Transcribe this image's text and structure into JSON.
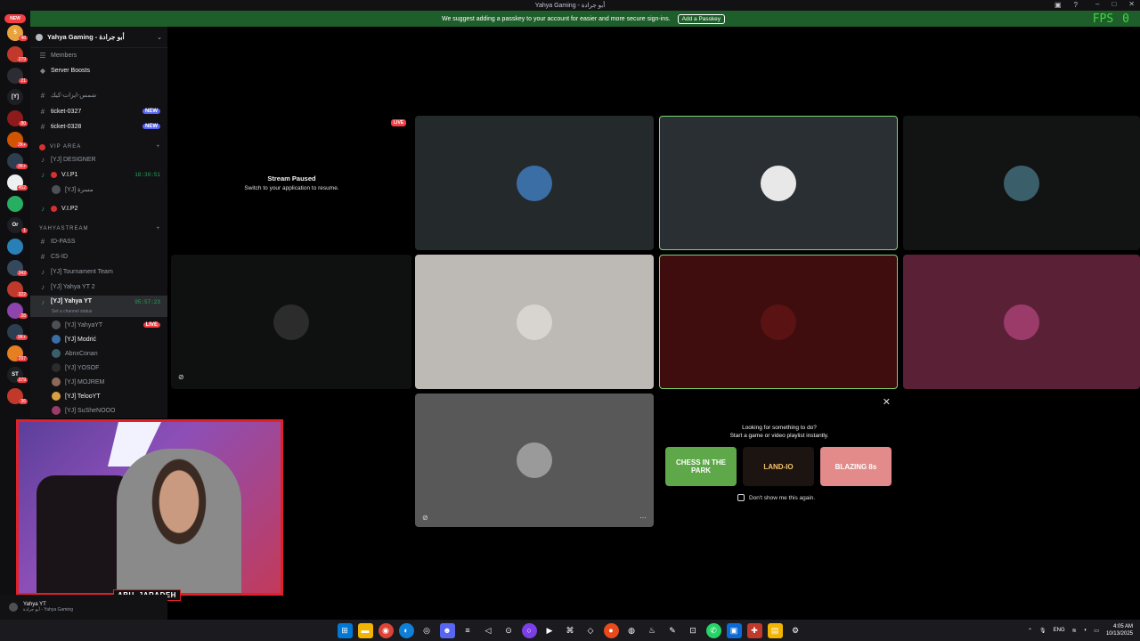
{
  "window": {
    "title": "Yahya Gaming - أبو جرادة"
  },
  "banner": {
    "message": "We suggest adding a passkey to your account for easier and more secure sign-ins.",
    "button": "Add a Passkey"
  },
  "fps": {
    "label": "FPS",
    "value": "0"
  },
  "rail": {
    "new_label": "NEW",
    "servers": [
      {
        "text": "5",
        "color": "#e8a33d",
        "badge": "48"
      },
      {
        "text": "",
        "color": "#c0392b",
        "badge": "279"
      },
      {
        "text": "",
        "color": "#2c2c34",
        "badge": "21"
      },
      {
        "text": "[Y]",
        "color": "#1e1f22",
        "badge": ""
      },
      {
        "text": "",
        "color": "#8e1b1b",
        "badge": "80"
      },
      {
        "text": "",
        "color": "#d35400",
        "badge": "2K+"
      },
      {
        "text": "",
        "color": "#2c3e50",
        "badge": "3K+"
      },
      {
        "text": "",
        "color": "#ecf0f1",
        "badge": "452"
      },
      {
        "text": "",
        "color": "#27ae60",
        "badge": ""
      },
      {
        "text": "Or",
        "color": "#1e1f22",
        "badge": "1"
      },
      {
        "text": "",
        "color": "#2980b9",
        "badge": ""
      },
      {
        "text": "",
        "color": "#34495e",
        "badge": "342"
      },
      {
        "text": "",
        "color": "#c0392b",
        "badge": "322"
      },
      {
        "text": "",
        "color": "#8e44ad",
        "badge": "28"
      },
      {
        "text": "",
        "color": "#2c3e50",
        "badge": "9K+"
      },
      {
        "text": "",
        "color": "#e67e22",
        "badge": "297"
      },
      {
        "text": "ST",
        "color": "#1e1f22",
        "badge": "379"
      },
      {
        "text": "",
        "color": "#c0392b",
        "badge": "36"
      }
    ]
  },
  "sidebar": {
    "server_name": "Yahya Gaming - أبو جرادة",
    "members": "Members",
    "boosts": "Server Boosts",
    "ch_arabic": "شمس-ايزات-كيك",
    "ticket1": "ticket-0327",
    "ticket2": "ticket-0328",
    "new": "NEW",
    "cat_vip": "VIP AREA",
    "designer": "[YJ] DESIGNER",
    "vip1": "V.I.P1",
    "vip1_time": "18:30:51",
    "vip1_user": "[YJ] مسرة",
    "vip2": "V.I.P2",
    "cat_stream": "YAHYASTREAM",
    "idpass": "ID-PASS",
    "csid": "CS-ID",
    "tournament": "[YJ] Tournament Team",
    "yahya2": "[YJ] Yahya YT 2",
    "yahya": "[YJ] Yahya YT",
    "yahya_time": "95:57:23",
    "yahya_status": "Set a channel status",
    "live": "LIVE",
    "users": [
      "[YJ] YahyaYT",
      "[YJ] Modrić",
      "AbnxConan",
      "[YJ] YOSOF",
      "[YJ] MOJREM",
      "[YJ] TelooYT",
      "[YJ] SuSheNOOO"
    ]
  },
  "stage": {
    "paused_title": "Stream Paused",
    "paused_sub": "Switch to your application to resume.",
    "live": "LIVE",
    "tiles": [
      {
        "bg": "#24292c",
        "avatar": "#3a6ea5",
        "border": ""
      },
      {
        "bg": "#2a2f33",
        "avatar": "#e8e8e8",
        "border": "#7ad56f"
      },
      {
        "bg": "#121313",
        "avatar": "#3b5f6a",
        "border": ""
      },
      {
        "bg": "#0f1010",
        "avatar": "#2c2c2c",
        "border": ""
      },
      {
        "bg": "#bdbab5",
        "avatar": "#d8d5d0",
        "border": ""
      },
      {
        "bg": "#3f0d0d",
        "avatar": "#5a1212",
        "border": "#7ad56f"
      },
      {
        "bg": "#5a2136",
        "avatar": "#9b3b6a",
        "border": ""
      },
      {
        "bg": "#585858",
        "avatar": "#9a9a9a",
        "border": ""
      }
    ]
  },
  "activity": {
    "line1": "Looking for something to do?",
    "line2": "Start a game or video playlist instantly.",
    "games": [
      "CHESS IN THE PARK",
      "LAND-IO",
      "BLAZING 8s"
    ],
    "dont_show": "Don't show me this again."
  },
  "webcam": {
    "name": "ABU_JARADEH"
  },
  "userpanel": {
    "name": "Yahya YT",
    "server": "أبو جرادة - Yahya Gaming"
  },
  "taskbar": {
    "lang": "ENG",
    "time": "4:05 AM",
    "date": "10/13/2025"
  }
}
